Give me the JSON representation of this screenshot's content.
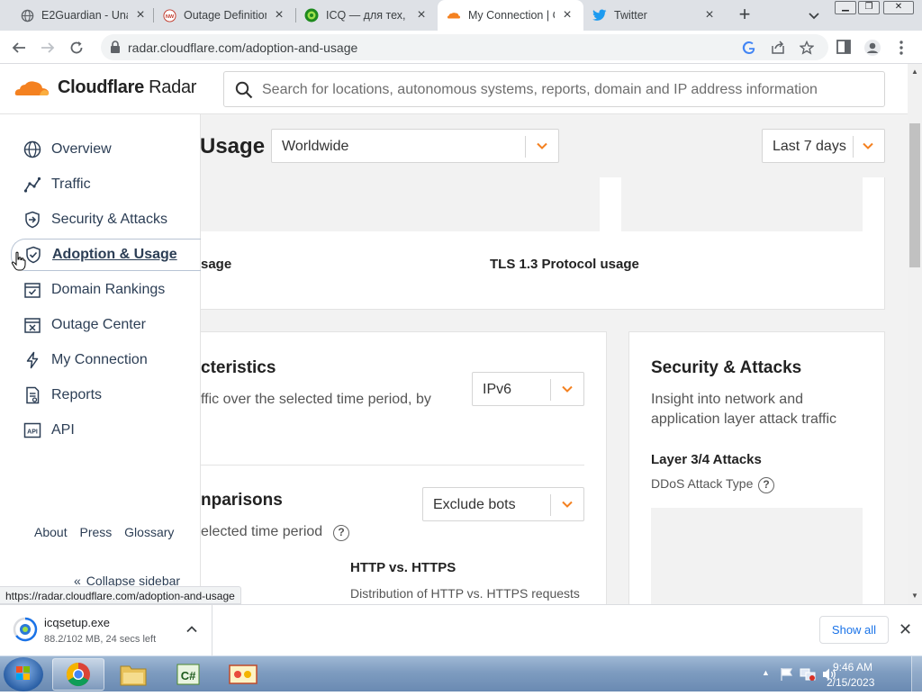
{
  "browser": {
    "tabs": [
      {
        "title": "E2Guardian - Una",
        "icon": "globe-icon"
      },
      {
        "title": "Outage Definition",
        "icon": "nw-site-icon"
      },
      {
        "title": "ICQ — для тех, кт",
        "icon": "icq-flower-icon"
      },
      {
        "title": "My Connection | C",
        "icon": "cloudflare-icon",
        "active": true
      },
      {
        "title": "Twitter",
        "icon": "twitter-bird-icon"
      }
    ],
    "url": "radar.cloudflare.com/adoption-and-usage",
    "status_url": "https://radar.cloudflare.com/adoption-and-usage"
  },
  "header": {
    "brand_bold": "Cloudflare",
    "brand_light": " Radar",
    "search_placeholder": "Search for locations, autonomous systems, reports, domain and IP address information"
  },
  "sidebar": {
    "items": [
      {
        "label": "Overview",
        "icon": "globe-icon"
      },
      {
        "label": "Traffic",
        "icon": "line-chart-icon"
      },
      {
        "label": "Security & Attacks",
        "icon": "shield-arrow-icon"
      },
      {
        "label": "Adoption & Usage",
        "icon": "shield-check-icon",
        "active": true
      },
      {
        "label": "Domain Rankings",
        "icon": "calendar-check-icon"
      },
      {
        "label": "Outage Center",
        "icon": "calendar-x-icon"
      },
      {
        "label": "My Connection",
        "icon": "lightning-icon"
      },
      {
        "label": "Reports",
        "icon": "document-icon"
      },
      {
        "label": "API",
        "icon": "api-icon"
      }
    ],
    "footer": [
      "About",
      "Press",
      "Glossary"
    ],
    "collapse_label": "Collapse sidebar"
  },
  "main": {
    "title": "Usage",
    "location_select": "Worldwide",
    "range_select": "Last 7 days",
    "top_card": {
      "left_label": "sage",
      "right_label": "TLS 1.3 Protocol usage"
    },
    "characteristics": {
      "title": "cteristics",
      "desc": "ffic over the selected time period, by",
      "select": "IPv6"
    },
    "comparisons": {
      "title": "nparisons",
      "desc": "elected time period",
      "select": "Exclude bots",
      "sub_title": "HTTP vs. HTTPS",
      "sub_desc": "Distribution of HTTP vs. HTTPS requests"
    },
    "security_card": {
      "title": "Security & Attacks",
      "desc": "Insight into network and application layer attack traffic",
      "sub_title": "Layer 3/4 Attacks",
      "sub_desc": "DDoS Attack Type"
    }
  },
  "download": {
    "filename": "icqsetup.exe",
    "status": "88.2/102 MB, 24 secs left",
    "show_all": "Show all"
  },
  "taskbar": {
    "time": "9:46 AM",
    "date": "2/15/2023"
  }
}
